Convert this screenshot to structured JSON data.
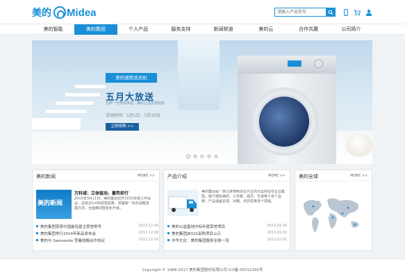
{
  "header": {
    "logo_cn": "美的",
    "logo_en": "Midea",
    "search_placeholder": "请输入产品型号",
    "icons": [
      "search-icon",
      "mobile-icon",
      "cart-icon",
      "user-icon"
    ]
  },
  "nav": {
    "items": [
      {
        "label": "美的智能",
        "active": false
      },
      {
        "label": "美的集团",
        "active": true
      },
      {
        "label": "个人产品",
        "active": false
      },
      {
        "label": "服务支持",
        "active": false
      },
      {
        "label": "新闻频道",
        "active": false
      },
      {
        "label": "美的云",
        "active": false
      },
      {
        "label": "合作共赢",
        "active": false
      },
      {
        "label": "公司简介",
        "active": false
      }
    ]
  },
  "banner": {
    "tag": "美的滚筒洗衣机",
    "title": "五月大放送",
    "subtitle": "全新一代洗衣体验，美的让洗衣更轻松",
    "date": "活动时间：5月1日 - 5月30日",
    "button": "立即抢购 >>",
    "slides": 5,
    "active_slide": 1
  },
  "news": {
    "title": "美的新闻",
    "more": "MORE >>",
    "image_text": "美的新闻",
    "lead_title": "万科城：立体驱动，蓄势前行",
    "lead_desc": "2015年3月11日，美的集团召开2015年度工作会议，总结2014年经营成果，部署新一年的战略发展方向，全面推动智能化升级。",
    "items": [
      {
        "title": "美的集团荣获中国最佳雇主荣誉称号",
        "date": "2013.12.30"
      },
      {
        "title": "美的集团举行2014年新品发布会",
        "date": "2013.12.30"
      },
      {
        "title": "美的与 Samsonite 签署战略合作协议",
        "date": "2013.12.03"
      }
    ]
  },
  "products": {
    "title": "产品介绍",
    "more": "MORE >>",
    "desc": "美的集团是一家以家电制造业为主的大型综合性企业集团，旗下拥有美的、小天鹅、威灵、华凌等十余个品牌，产品涵盖空调、冰箱、洗衣机等多个领域。",
    "items": [
      {
        "title": "美的公益基地中标年度荣誉项目",
        "date": "2013.03.30"
      },
      {
        "title": "美的集团JB322采购项目公示",
        "date": "2013.03.30"
      },
      {
        "title": "中华文化：美的集团服务全球一流",
        "date": "2013.02.01"
      }
    ]
  },
  "global": {
    "title": "美的全球",
    "more": "MORE >>"
  },
  "footer": {
    "text": "Copyright © 1968-2017 美的集团股份有限公司 ICP备 05012345号"
  }
}
